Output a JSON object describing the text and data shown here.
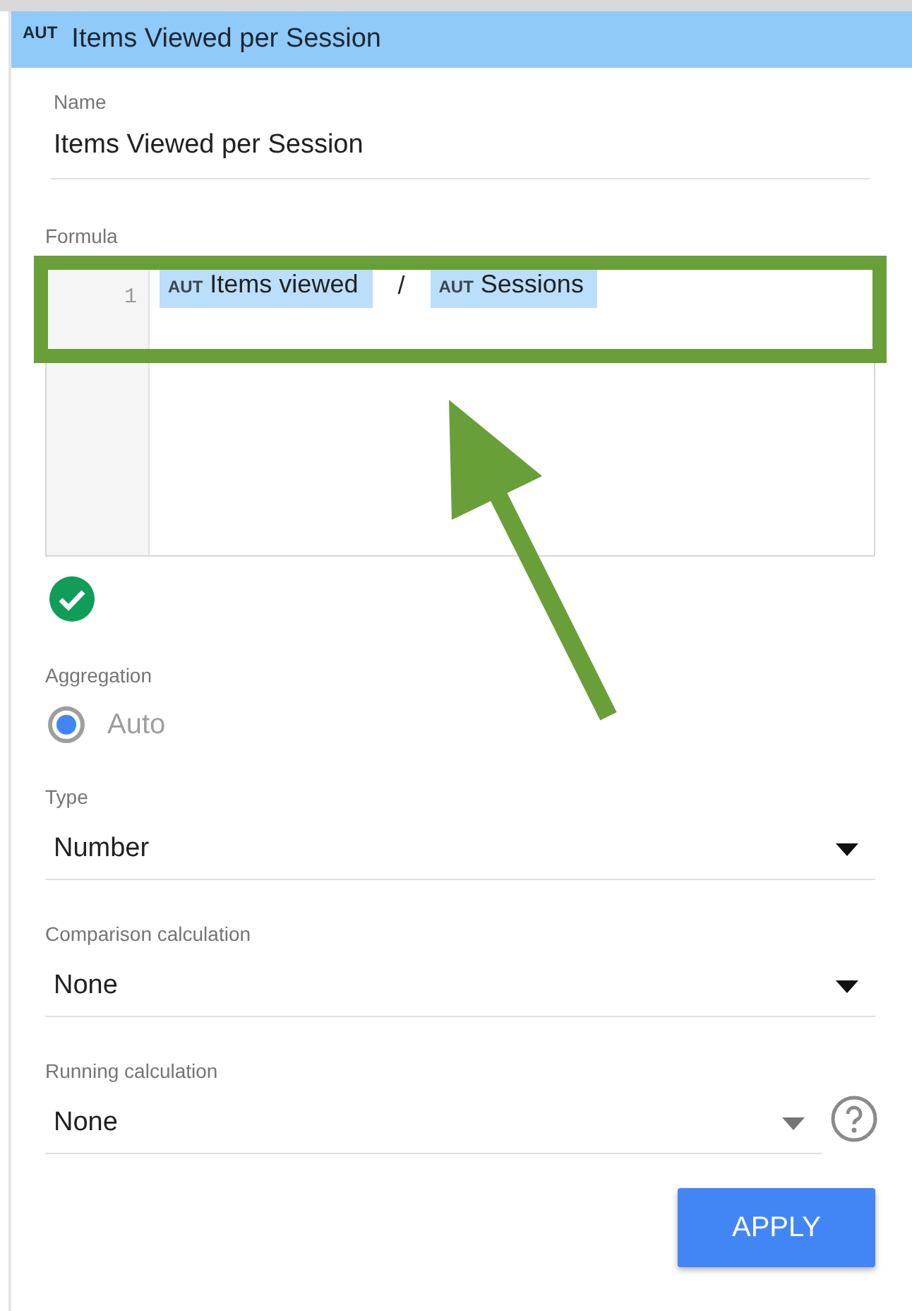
{
  "header": {
    "badge": "AUT",
    "title": "Items Viewed per Session"
  },
  "name_field": {
    "label": "Name",
    "value": "Items Viewed per Session"
  },
  "formula": {
    "label": "Formula",
    "line_number": "1",
    "valid": true,
    "tokens": [
      {
        "kind": "field",
        "badge": "AUT",
        "text": "Items viewed"
      },
      {
        "kind": "operator",
        "text": "/"
      },
      {
        "kind": "field",
        "badge": "AUT",
        "text": "Sessions"
      }
    ]
  },
  "aggregation": {
    "label": "Aggregation",
    "options": [
      {
        "label": "Auto",
        "selected": true,
        "disabled": true
      }
    ]
  },
  "selects": [
    {
      "label": "Type",
      "value": "Number",
      "disabled": false,
      "help": false
    },
    {
      "label": "Comparison calculation",
      "value": "None",
      "disabled": false,
      "help": false
    },
    {
      "label": "Running calculation",
      "value": "None",
      "disabled": true,
      "help": true
    }
  ],
  "apply_button": {
    "label": "APPLY"
  }
}
